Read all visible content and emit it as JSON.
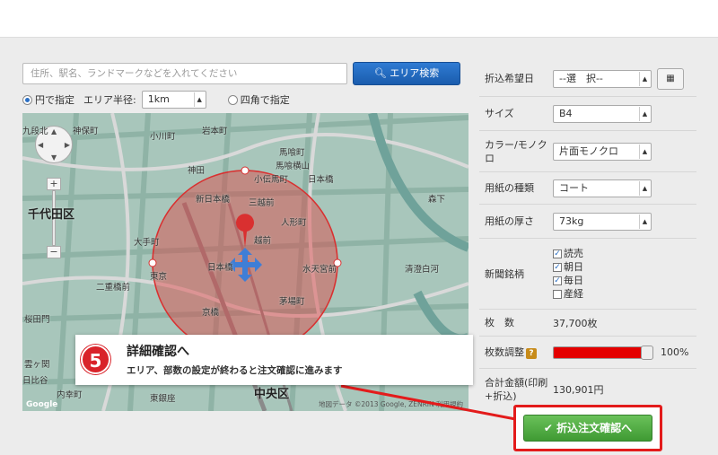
{
  "search": {
    "placeholder": "住所、駅名、ランドマークなどを入れてください",
    "button_label": "エリア検索",
    "button_icon": "search-icon",
    "accent": "#1f66bd"
  },
  "area_options": {
    "circle_label": "円で指定",
    "radius_label": "エリア半径:",
    "radius_value": "1km",
    "square_label": "四角で指定",
    "selected": "circle"
  },
  "map": {
    "labels": [
      "九段北",
      "神保町",
      "小川町",
      "岩本町",
      "馬喰町",
      "馬喰横山",
      "神田",
      "小伝馬町",
      "日本橋",
      "新日本橋",
      "三越前",
      "人形町",
      "森下",
      "千代田区",
      "大手町",
      "越前",
      "水天宮前",
      "清澄白河",
      "東京",
      "日本橋",
      "二重橋前",
      "茅場町",
      "京橋",
      "桜田門",
      "中央区",
      "雲ヶ関",
      "内幸町",
      "東銀座",
      "日比谷",
      "Google",
      "地図データ ©2013 Google, ZENRIN",
      "利用規約"
    ],
    "circle_color": "#e04040"
  },
  "callout": {
    "step": "5",
    "title": "詳細確認へ",
    "description": "エリア、部数の設定が終わると注文確認に進みます"
  },
  "form": {
    "date_label": "折込希望日",
    "date_value": "--選　択--",
    "calendar_icon": "calendar-icon",
    "size_label": "サイズ",
    "size_value": "B4",
    "color_label": "カラー/モノクロ",
    "color_value": "片面モノクロ",
    "paper_label": "用紙の種類",
    "paper_value": "コート",
    "thickness_label": "用紙の厚さ",
    "thickness_value": "73kg",
    "newspaper_label": "新聞銘柄",
    "newspapers": [
      {
        "name": "読売",
        "checked": true
      },
      {
        "name": "朝日",
        "checked": true
      },
      {
        "name": "毎日",
        "checked": true
      },
      {
        "name": "産経",
        "checked": false
      }
    ],
    "count_label": "枚　数",
    "count_value": "37,700枚",
    "adjust_label": "枚数調整",
    "adjust_help": "?",
    "adjust_percent": "100%",
    "adjust_fraction": 1.0,
    "slider_color": "#e40000",
    "total_label": "合計金額(印刷+折込)",
    "total_value": "130,901円"
  },
  "order_button": {
    "label": "折込注文確認へ",
    "icon": "check-icon",
    "color": "#4caa3f",
    "highlight": "#e31b1b"
  }
}
